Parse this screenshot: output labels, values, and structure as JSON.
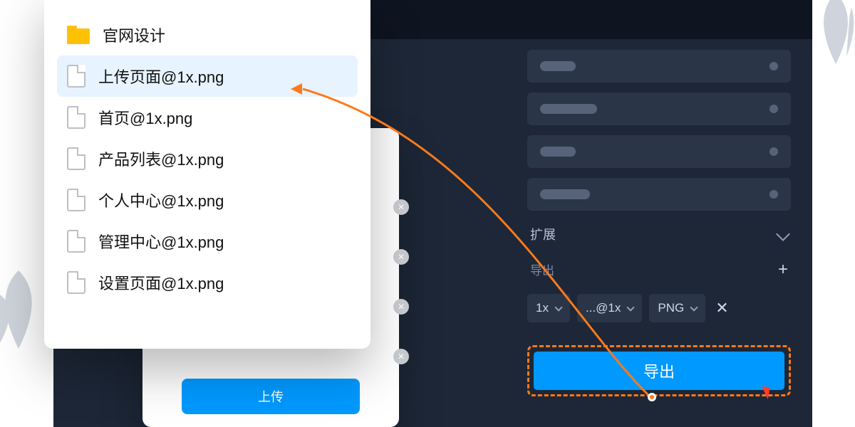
{
  "filebrowser": {
    "folder": "官网设计",
    "files": [
      "上传页面@1x.png",
      "首页@1x.png",
      "产品列表@1x.png",
      "个人中心@1x.png",
      "管理中心@1x.png",
      "设置页面@1x.png"
    ],
    "selected_index": 0
  },
  "modal": {
    "upload_label": "上传"
  },
  "inspector": {
    "expand_section": "扩展",
    "export_label": "导出",
    "size_chip": "1x",
    "suffix_chip": "...@1x",
    "format_chip": "PNG",
    "export_button": "导出"
  },
  "colors": {
    "accent": "#0099ff",
    "highlight": "#ff7a1a",
    "dark_bg": "#1d2737"
  }
}
